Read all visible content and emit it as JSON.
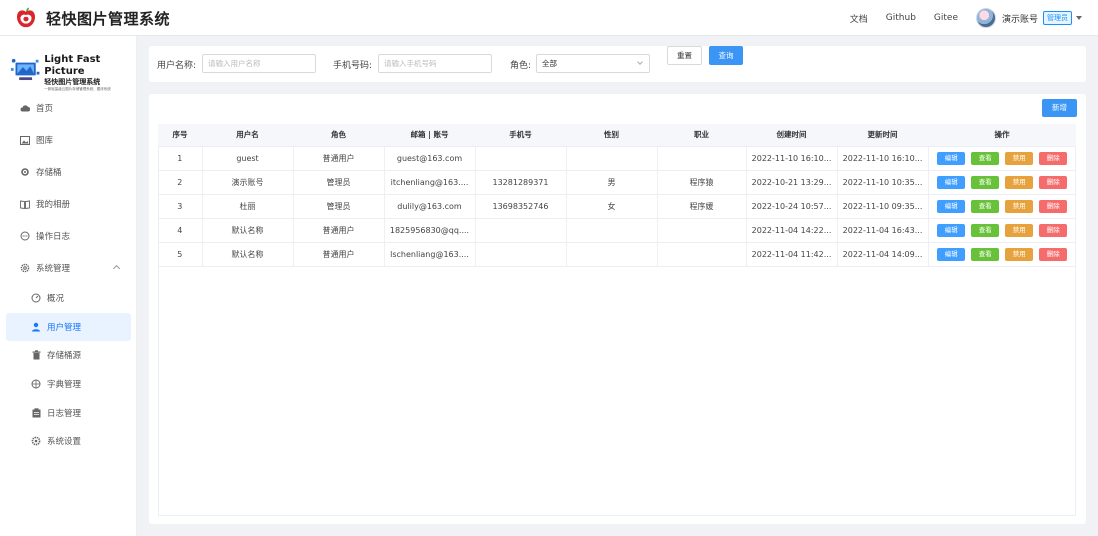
{
  "header": {
    "app_title": "轻快图片管理系统",
    "links": [
      "文档",
      "Github",
      "Gitee"
    ],
    "user_name": "演示账号",
    "user_role": "管理员"
  },
  "sidebar": {
    "logo_en": "Light Fast Picture",
    "logo_cn": "轻快图片管理系统",
    "logo_sub": "一款轻量级云图片存储管理系统、图床系统",
    "items": [
      {
        "label": "首页",
        "icon": "cloud-icon"
      },
      {
        "label": "图库",
        "icon": "image-icon"
      },
      {
        "label": "存储桶",
        "icon": "bucket-icon"
      },
      {
        "label": "我的相册",
        "icon": "album-icon"
      },
      {
        "label": "操作日志",
        "icon": "chat-icon"
      },
      {
        "label": "系统管理",
        "icon": "settings-icon"
      }
    ],
    "sub_items": [
      {
        "label": "概况",
        "icon": "dashboard-icon"
      },
      {
        "label": "用户管理",
        "icon": "user-icon",
        "active": true
      },
      {
        "label": "存储桶源",
        "icon": "trash-icon"
      },
      {
        "label": "字典管理",
        "icon": "globe-icon"
      },
      {
        "label": "日志管理",
        "icon": "log-icon"
      },
      {
        "label": "系统设置",
        "icon": "gear-icon"
      }
    ]
  },
  "search": {
    "username_label": "用户名称:",
    "username_placeholder": "请输入用户名称",
    "phone_label": "手机号码:",
    "phone_placeholder": "请输入手机号码",
    "role_label": "角色:",
    "role_value": "全部",
    "reset_label": "重置",
    "query_label": "查询"
  },
  "table": {
    "add_label": "新增",
    "columns": [
      "序号",
      "用户名",
      "角色",
      "邮箱 | 账号",
      "手机号",
      "性别",
      "职业",
      "创建时间",
      "更新时间",
      "操作"
    ],
    "ops": {
      "edit": "编辑",
      "view": "查看",
      "disable": "禁用",
      "delete": "删除"
    },
    "rows": [
      [
        "1",
        "guest",
        "普通用户",
        "guest@163.com",
        "",
        "",
        "",
        "2022-11-10 16:10...",
        "2022-11-10 16:10..."
      ],
      [
        "2",
        "演示账号",
        "管理员",
        "itchenliang@163....",
        "13281289371",
        "男",
        "程序猿",
        "2022-10-21 13:29...",
        "2022-11-10 10:35..."
      ],
      [
        "3",
        "杜丽",
        "管理员",
        "dulily@163.com",
        "13698352746",
        "女",
        "程序媛",
        "2022-10-24 10:57...",
        "2022-11-10 09:35..."
      ],
      [
        "4",
        "默认名称",
        "普通用户",
        "1825956830@qq....",
        "",
        "",
        "",
        "2022-11-04 14:22...",
        "2022-11-04 16:43..."
      ],
      [
        "5",
        "默认名称",
        "普通用户",
        "lschenliang@163....",
        "",
        "",
        "",
        "2022-11-04 11:42...",
        "2022-11-04 14:09..."
      ]
    ]
  },
  "colors": {
    "primary": "#409eff",
    "success": "#67c23a",
    "warning": "#e6a23c",
    "danger": "#f56c6c",
    "active_bg": "#e8f3ff"
  }
}
